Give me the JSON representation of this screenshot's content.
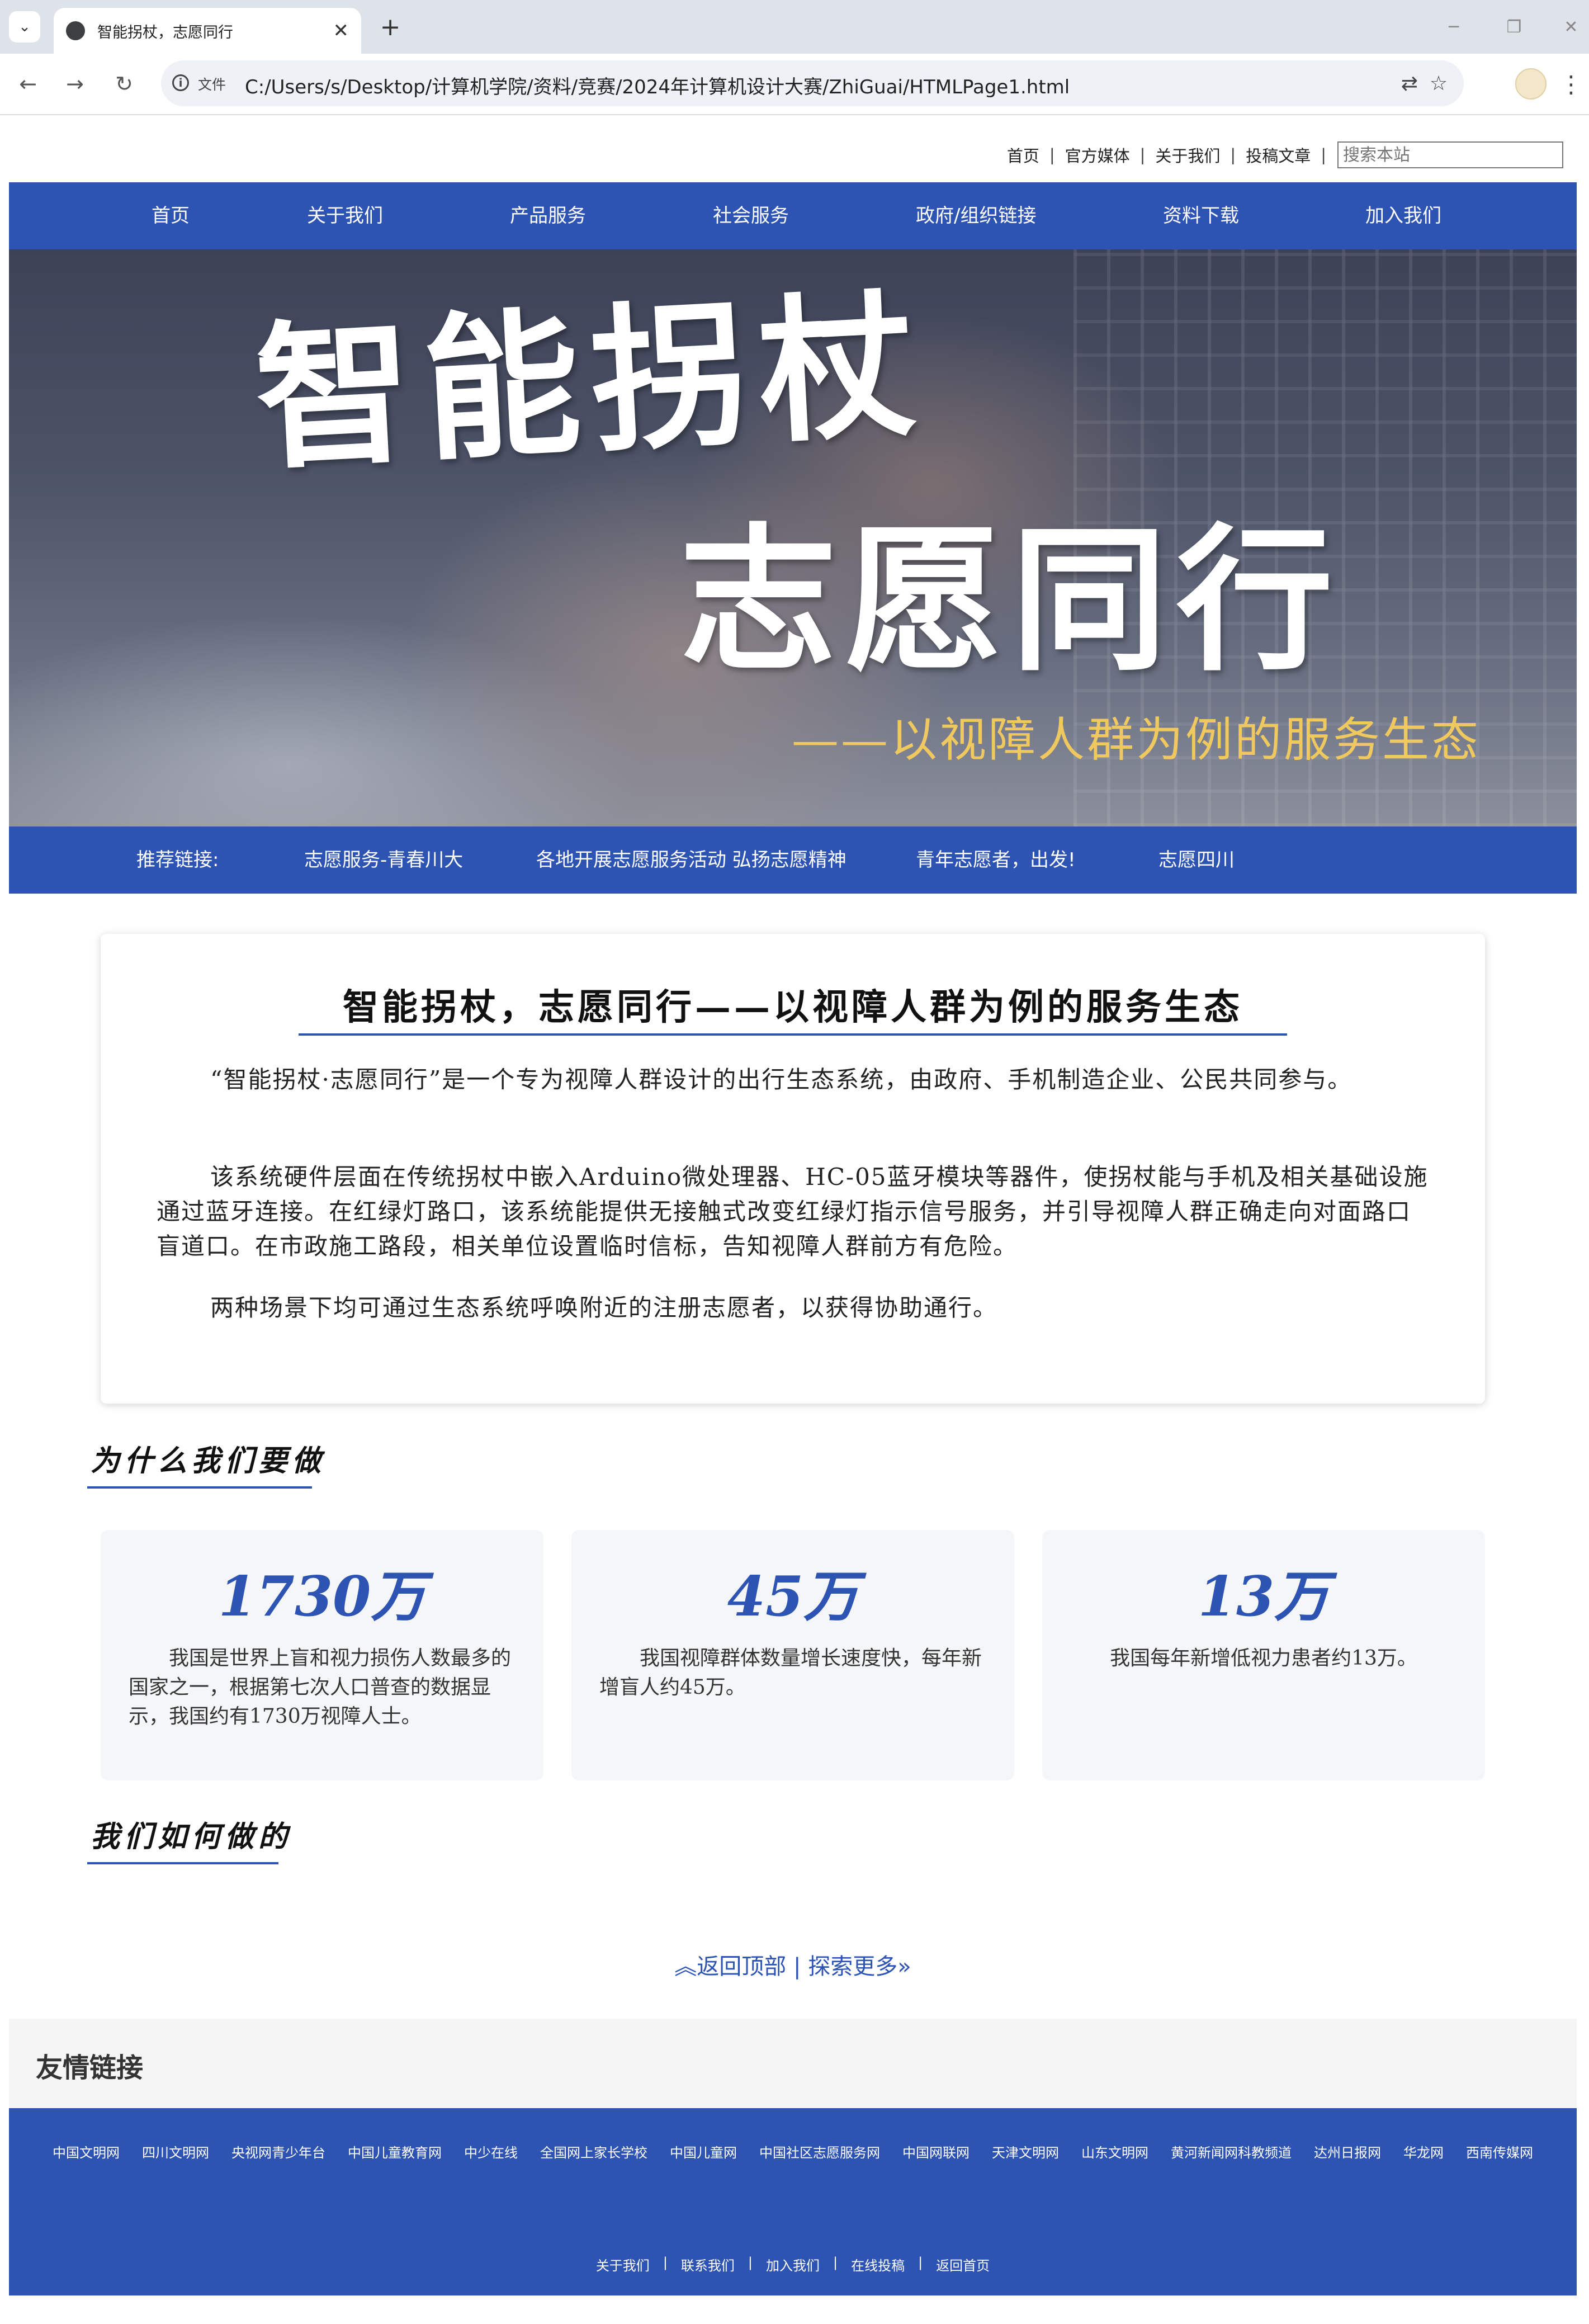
{
  "browser": {
    "tab_title": "智能拐杖，志愿同行",
    "url_chip": "文件",
    "url": "C:/Users/s/Desktop/计算机学院/资料/竞赛/2024年计算机设计大赛/ZhiGuai/HTMLPage1.html"
  },
  "top_links": [
    "首页",
    "官方媒体",
    "关于我们",
    "投稿文章"
  ],
  "top_sep": "|",
  "search_placeholder": "搜索本站",
  "main_nav": [
    "首页",
    "关于我们",
    "产品服务",
    "社会服务",
    "政府/组织链接",
    "资料下载",
    "加入我们"
  ],
  "banner": {
    "line1": "智能拐杖",
    "line2": "志愿同行",
    "sub": "——以视障人群为例的服务生态"
  },
  "recommend": {
    "label": "推荐链接:",
    "links": [
      "志愿服务-青春川大",
      "各地开展志愿服务活动 弘扬志愿精神",
      "青年志愿者，出发!",
      "志愿四川"
    ]
  },
  "intro": {
    "title": "智能拐杖，志愿同行——以视障人群为例的服务生态",
    "paragraphs": [
      "“智能拐杖·志愿同行”是一个专为视障人群设计的出行生态系统，由政府、手机制造企业、公民共同参与。",
      "该系统硬件层面在传统拐杖中嵌入Arduino微处理器、HC-05蓝牙模块等器件，使拐杖能与手机及相关基础设施通过蓝牙连接。在红绿灯路口，该系统能提供无接触式改变红绿灯指示信号服务，并引导视障人群正确走向对面路口盲道口。在市政施工路段，相关单位设置临时信标，告知视障人群前方有危险。",
      "两种场景下均可通过生态系统呼唤附近的注册志愿者，以获得协助通行。"
    ]
  },
  "why": {
    "heading": "为什么我们要做",
    "stats": [
      {
        "number": "1730万",
        "text": "我国是世界上盲和视力损伤人数最多的国家之一，根据第七次人口普查的数据显示，我国约有1730万视障人士。"
      },
      {
        "number": "45万",
        "text": "我国视障群体数量增长速度快，每年新增盲人约45万。"
      },
      {
        "number": "13万",
        "text": "我国每年新增低视力患者约13万。"
      }
    ]
  },
  "how": {
    "heading": "我们如何做的"
  },
  "back_top": {
    "up": "返回顶部",
    "sep": "|",
    "more": "探索更多"
  },
  "friends": {
    "title": "友情链接",
    "links": [
      "中国文明网",
      "四川文明网",
      "央视网青少年台",
      "中国儿童教育网",
      "中少在线",
      "全国网上家长学校",
      "中国儿童网",
      "中国社区志愿服务网",
      "中国网联网",
      "天津文明网",
      "山东文明网",
      "黄河新闻网科教频道",
      "达州日报网",
      "华龙网",
      "西南传媒网"
    ]
  },
  "footer": {
    "links": [
      "关于我们",
      "联系我们",
      "加入我们",
      "在线投稿",
      "返回首页"
    ],
    "sep": "|"
  },
  "colors": {
    "brand_blue": "#2d53b3",
    "banner_subtitle": "#f0c860"
  }
}
